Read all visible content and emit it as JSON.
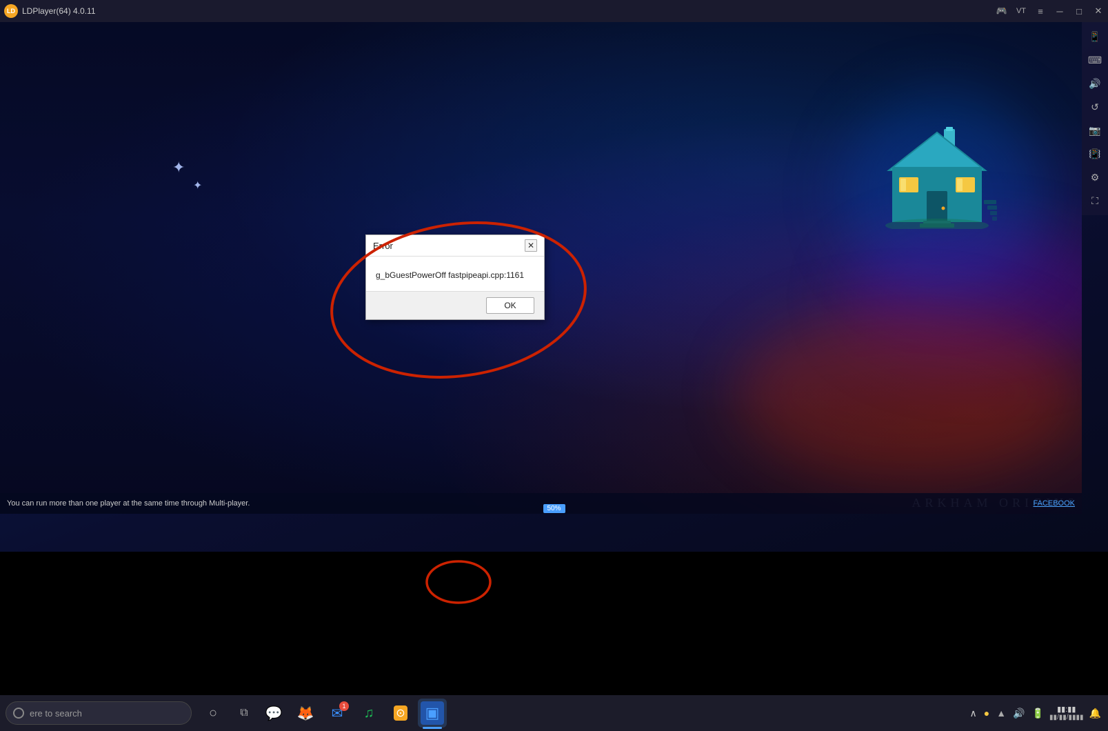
{
  "window": {
    "title": "LDPlayer(64) 4.0.11",
    "logo_char": "●"
  },
  "titlebar": {
    "title": "LDPlayer(64) 4.0.11",
    "controls": {
      "gamepad_icon": "⊡",
      "vt_label": "VT",
      "menu_icon": "≡",
      "minimize_icon": "─",
      "maximize_icon": "□",
      "close_icon": "✕"
    }
  },
  "info_bar": {
    "text": "You can run more than one player at the same time through Multi-player.",
    "facebook_link": "FACEBOOK"
  },
  "progress": {
    "value": "50%"
  },
  "arkham": {
    "text": "ARKHAM ORIGINS"
  },
  "dialog": {
    "title": "Error",
    "message": "g_bGuestPowerOff fastpipeapi.cpp:1161",
    "ok_label": "OK",
    "close_icon": "✕"
  },
  "taskbar": {
    "search_placeholder": "ere to search",
    "apps": [
      {
        "id": "search-btn",
        "icon": "○",
        "label": "Search"
      },
      {
        "id": "taskview-btn",
        "icon": "⧉",
        "label": "Task View"
      },
      {
        "id": "messenger-app",
        "icon": "💬",
        "label": "Messenger"
      },
      {
        "id": "firefox-app",
        "icon": "🦊",
        "label": "Firefox"
      },
      {
        "id": "mail-app",
        "icon": "✉",
        "label": "Mail",
        "badge": "1"
      },
      {
        "id": "spotify-app",
        "icon": "♪",
        "label": "Spotify"
      },
      {
        "id": "ld-store-app",
        "icon": "⊙",
        "label": "LD Store"
      },
      {
        "id": "ldplayer-app",
        "icon": "▣",
        "label": "LDPlayer",
        "active": true
      }
    ],
    "tray": {
      "chevron_icon": "∧",
      "coin_icon": "●",
      "wifi_icon": "▲",
      "sound_icon": "♪",
      "battery_icon": "▮",
      "time": "▮▮",
      "notification_icon": "🔔"
    }
  },
  "colors": {
    "accent_blue": "#4a9fff",
    "title_bar_bg": "#1a1a2e",
    "taskbar_bg": "#1c1c2a",
    "dialog_bg": "#ffffff",
    "error_red": "#cc2200"
  }
}
